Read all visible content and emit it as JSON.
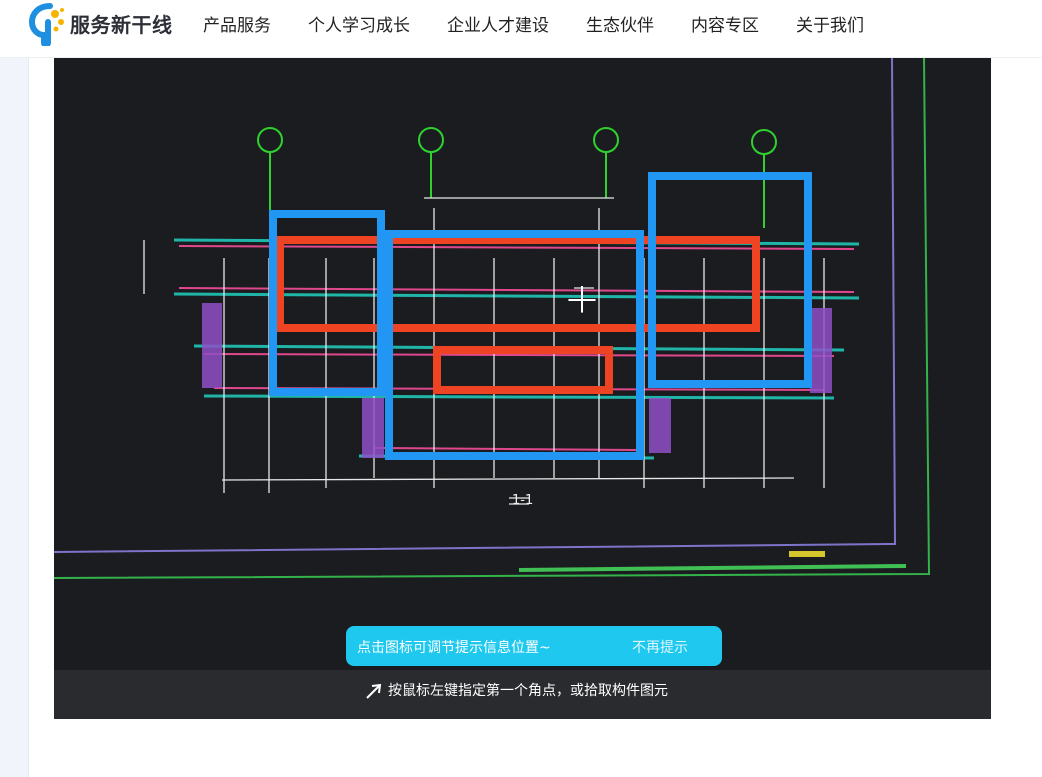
{
  "header": {
    "logo_text": "服务新干线",
    "nav": [
      "产品服务",
      "个人学习成长",
      "企业人才建设",
      "生态伙伴",
      "内容专区",
      "关于我们"
    ]
  },
  "photo": {
    "section_label": "1-1",
    "tooltip_text": "点击图标可调节提示信息位置~",
    "tooltip_dismiss": "不再提示",
    "command_prompt": "按鼠标左键指定第一个角点，或拾取构件图元"
  },
  "colors": {
    "brand_blue": "#1f8fe0",
    "brand_yellow": "#f5b400",
    "annotation_red": "#ee4423",
    "annotation_blue": "#2196f3",
    "cad_background": "#1b1c1f",
    "tooltip_cyan": "#1ec8ee"
  }
}
